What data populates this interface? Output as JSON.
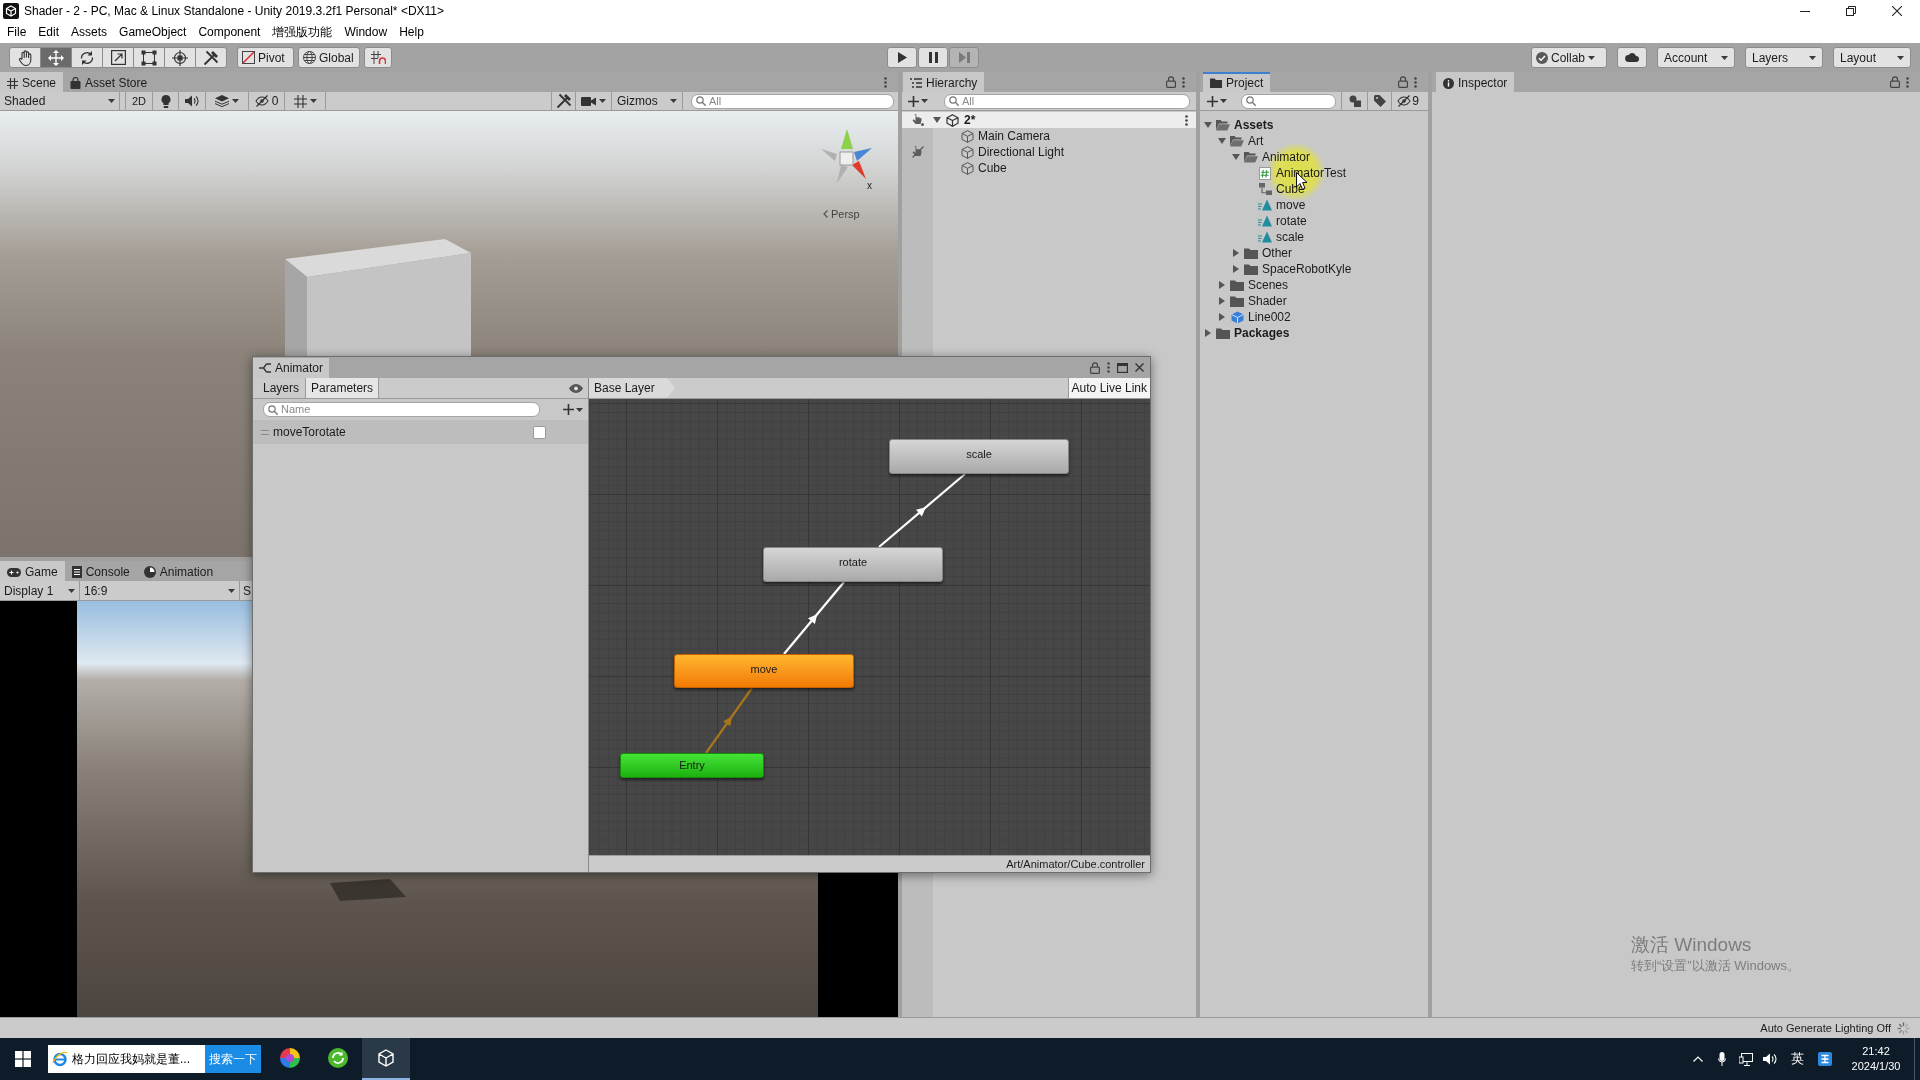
{
  "window": {
    "title": "Shader - 2 - PC, Mac & Linux Standalone - Unity 2019.3.2f1 Personal* <DX11>"
  },
  "menu": [
    "File",
    "Edit",
    "Assets",
    "GameObject",
    "Component",
    "增强版功能",
    "Window",
    "Help"
  ],
  "toolbar": {
    "tools": [
      {
        "kind": "hand",
        "selected": false
      },
      {
        "kind": "move",
        "selected": true
      },
      {
        "kind": "rotate",
        "selected": false
      },
      {
        "kind": "scale",
        "selected": false
      },
      {
        "kind": "rect",
        "selected": false
      },
      {
        "kind": "transform",
        "selected": false
      },
      {
        "kind": "custom",
        "selected": false
      }
    ],
    "pivot": "Pivot",
    "global": "Global",
    "collab": "Collab",
    "account": "Account",
    "layers": "Layers",
    "layout": "Layout"
  },
  "scene_panel": {
    "tabs": [
      {
        "label": "Scene",
        "kind": "scene",
        "selected": true
      },
      {
        "label": "Asset Store",
        "kind": "store",
        "selected": false
      }
    ],
    "shading": "Shaded",
    "mode_2d": "2D",
    "toggles": [
      {
        "kind": "lighting",
        "on": false
      },
      {
        "kind": "audio",
        "on": false
      },
      {
        "kind": "effects",
        "on": false
      }
    ],
    "hidden_count": "0",
    "gizmos": "Gizmos",
    "search": {
      "placeholder": "All"
    },
    "axis_label": "x",
    "projection": "Persp"
  },
  "game_panel": {
    "tabs": [
      {
        "label": "Game",
        "kind": "game",
        "selected": true
      },
      {
        "label": "Console",
        "kind": "console",
        "selected": false
      },
      {
        "label": "Animation",
        "kind": "animation",
        "selected": false
      }
    ],
    "display": "Display 1",
    "aspect": "16:9",
    "toolbar_text": "S"
  },
  "hierarchy": {
    "tab": "Hierarchy",
    "focused": false,
    "search": {
      "placeholder": "All"
    },
    "scene": {
      "label": "2*",
      "expanded": true,
      "children": [
        {
          "label": "Main Camera",
          "pickable": true
        },
        {
          "label": "Directional Light",
          "pickable": false
        },
        {
          "label": "Cube",
          "pickable": true
        }
      ]
    }
  },
  "project": {
    "tab": "Project",
    "focused": true,
    "hidden_count": "9",
    "tree": [
      {
        "label": "Assets",
        "kind": "folder",
        "expanded": true,
        "children": [
          {
            "label": "Art",
            "kind": "folder",
            "expanded": true,
            "children": [
              {
                "label": "Animator",
                "kind": "folder",
                "expanded": true,
                "children": [
                  {
                    "label": "AnimatorTest",
                    "kind": "script"
                  },
                  {
                    "label": "Cube",
                    "kind": "controller"
                  },
                  {
                    "label": "move",
                    "kind": "clip"
                  },
                  {
                    "label": "rotate",
                    "kind": "clip"
                  },
                  {
                    "label": "scale",
                    "kind": "clip"
                  }
                ]
              },
              {
                "label": "Other",
                "kind": "folder",
                "expanded": false
              },
              {
                "label": "SpaceRobotKyle",
                "kind": "folder",
                "expanded": false
              }
            ]
          },
          {
            "label": "Scenes",
            "kind": "folder",
            "expanded": false
          },
          {
            "label": "Shader",
            "kind": "folder",
            "expanded": false
          },
          {
            "label": "Line002",
            "kind": "prefab",
            "expanded": false
          }
        ]
      },
      {
        "label": "Packages",
        "kind": "folder",
        "expanded": false
      }
    ]
  },
  "inspector": {
    "tab": "Inspector",
    "focused": false
  },
  "animator": {
    "title": "Animator",
    "tabs": [
      {
        "label": "Layers",
        "selected": false
      },
      {
        "label": "Parameters",
        "selected": true
      }
    ],
    "search": {
      "placeholder": "Name"
    },
    "parameters": [
      {
        "name": "moveTorotate",
        "checked": false
      }
    ],
    "breadcrumb": "Base Layer",
    "live_link": "Auto Live Link",
    "states": [
      {
        "label": "scale",
        "kind": "state"
      },
      {
        "label": "rotate",
        "kind": "state"
      },
      {
        "label": "move",
        "kind": "default"
      },
      {
        "label": "Entry",
        "kind": "entry"
      }
    ],
    "path": "Art/Animator/Cube.controller"
  },
  "status_bar": {
    "text": "Auto Generate Lighting Off"
  },
  "activation_notice": {
    "title": "激活 Windows",
    "text": "转到“设置”以激活 Windows。"
  },
  "taskbar": {
    "search": {
      "value": "格力回应我妈就是董..."
    },
    "search_button": "搜索一下",
    "apps": [
      {
        "kind": "colorwheel",
        "selected": false
      },
      {
        "kind": "refresh",
        "selected": false
      },
      {
        "kind": "cube",
        "selected": true
      }
    ],
    "input_language": "英",
    "clock": {
      "time": "21:42",
      "date": "2024/1/30"
    }
  }
}
